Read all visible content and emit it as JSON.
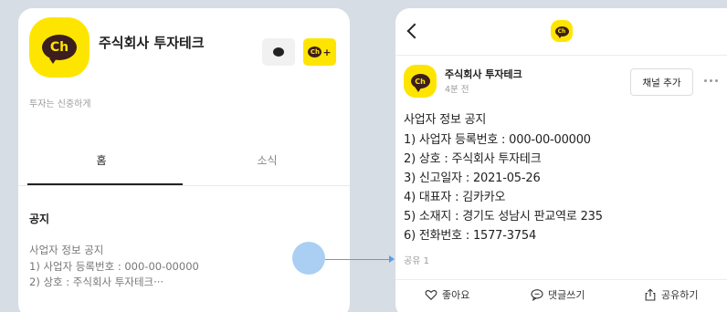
{
  "left_panel": {
    "logo_text": "Ch",
    "channel_name": "주식회사 투자테크",
    "add_channel_logo_text": "Ch",
    "add_channel_plus": "+",
    "tagline": "투자는 신중하게",
    "tabs": [
      {
        "label": "홈"
      },
      {
        "label": "소식"
      }
    ],
    "notice_heading": "공지",
    "notice_preview": [
      "사업자 정보 공지",
      "1) 사업자 등록번호 : 000-00-00000",
      "2) 상호 : 주식회사 투자테크···"
    ]
  },
  "right_panel": {
    "header_logo_text": "Ch",
    "post": {
      "logo_text": "Ch",
      "channel_name": "주식회사 투자테크",
      "time": "4분 전",
      "add_channel_label": "채널 추가",
      "body": [
        "사업자 정보 공지",
        "1) 사업자 등록번호 : 000-00-00000",
        "2) 상호 : 주식회사 투자테크",
        "3) 신고일자 : 2021-05-26",
        "4) 대표자 : 김카카오",
        "5) 소재지 : 경기도 성남시 판교역로 235",
        "6) 전화번호 : 1577-3754"
      ],
      "share_count": "공유 1"
    },
    "actions": {
      "like": "좋아요",
      "comment": "댓글쓰기",
      "share": "공유하기"
    }
  },
  "colors": {
    "background": "#d7dde4",
    "brand_yellow": "#fee500",
    "brand_brown": "#3c1e1e",
    "touch_indicator": "#abcff3",
    "connector": "#5b9ce6"
  },
  "icons": [
    "chat-bubble-icon",
    "add-channel-icon",
    "back-chevron-icon",
    "more-dots-icon",
    "heart-icon",
    "comment-icon",
    "share-icon"
  ]
}
